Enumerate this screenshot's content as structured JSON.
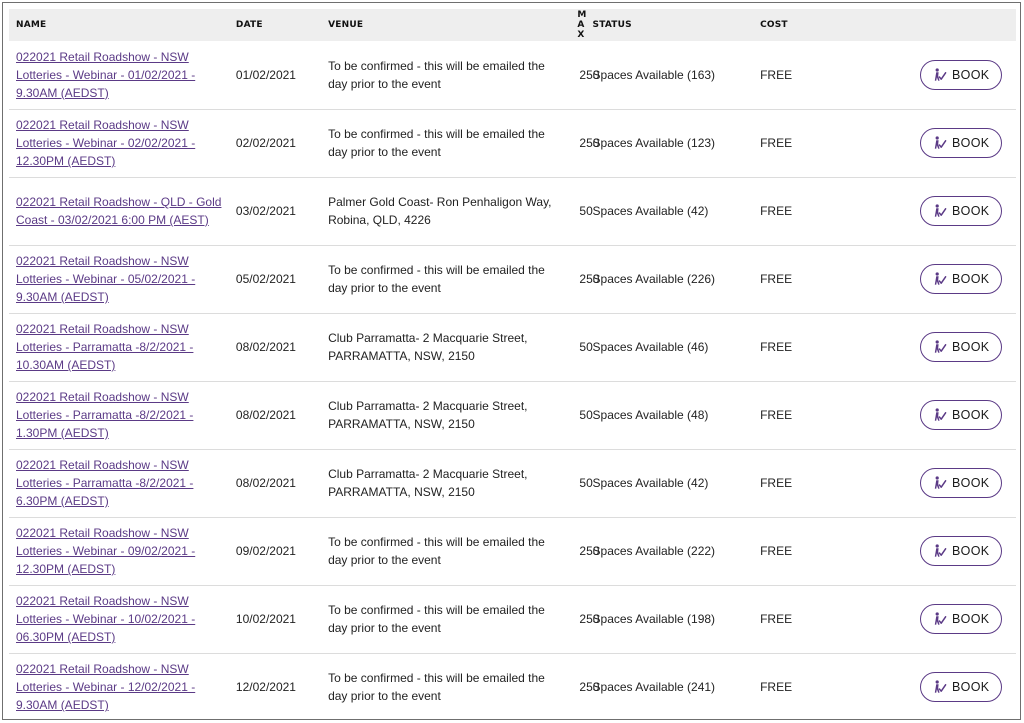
{
  "table": {
    "headers": {
      "name": "NAME",
      "date": "DATE",
      "venue": "VENUE",
      "max": "MAX",
      "status": "STATUS",
      "cost": "COST"
    },
    "rows": [
      {
        "name": "022021 Retail Roadshow - NSW Lotteries - Webinar - 01/02/2021 - 9.30AM (AEDST)",
        "date": "01/02/2021",
        "venue": "To be confirmed - this will be emailed the day prior to the event",
        "max": "250",
        "status": "Spaces Available (163)",
        "cost": "FREE",
        "book": "BOOK"
      },
      {
        "name": "022021 Retail Roadshow - NSW Lotteries - Webinar - 02/02/2021 - 12.30PM (AEDST)",
        "date": "02/02/2021",
        "venue": "To be confirmed - this will be emailed the day prior to the event",
        "max": "250",
        "status": "Spaces Available (123)",
        "cost": "FREE",
        "book": "BOOK"
      },
      {
        "name": "022021 Retail Roadshow - QLD - Gold Coast - 03/02/2021 6:00 PM (AEST)",
        "date": "03/02/2021",
        "venue": "Palmer Gold Coast- Ron Penhaligon Way, Robina, QLD, 4226",
        "max": "50",
        "status": "Spaces Available (42)",
        "cost": "FREE",
        "book": "BOOK"
      },
      {
        "name": "022021 Retail Roadshow - NSW Lotteries - Webinar - 05/02/2021 - 9.30AM (AEDST)",
        "date": "05/02/2021",
        "venue": "To be confirmed - this will be emailed the day prior to the event",
        "max": "250",
        "status": "Spaces Available (226)",
        "cost": "FREE",
        "book": "BOOK"
      },
      {
        "name": "022021 Retail Roadshow - NSW Lotteries - Parramatta -8/2/2021 - 10.30AM (AEDST)",
        "date": "08/02/2021",
        "venue": "Club Parramatta- 2 Macquarie Street, PARRAMATTA, NSW, 2150",
        "max": "50",
        "status": "Spaces Available (46)",
        "cost": "FREE",
        "book": "BOOK"
      },
      {
        "name": "022021 Retail Roadshow - NSW Lotteries - Parramatta -8/2/2021 - 1.30PM (AEDST)",
        "date": "08/02/2021",
        "venue": "Club Parramatta- 2 Macquarie Street, PARRAMATTA, NSW, 2150",
        "max": "50",
        "status": "Spaces Available (48)",
        "cost": "FREE",
        "book": "BOOK"
      },
      {
        "name": "022021 Retail Roadshow - NSW Lotteries - Parramatta -8/2/2021 - 6.30PM (AEDST)",
        "date": "08/02/2021",
        "venue": "Club Parramatta- 2 Macquarie Street, PARRAMATTA, NSW, 2150",
        "max": "50",
        "status": "Spaces Available (42)",
        "cost": "FREE",
        "book": "BOOK"
      },
      {
        "name": "022021 Retail Roadshow - NSW Lotteries - Webinar - 09/02/2021 - 12.30PM (AEDST)",
        "date": "09/02/2021",
        "venue": "To be confirmed - this will be emailed the day prior to the event",
        "max": "250",
        "status": "Spaces Available (222)",
        "cost": "FREE",
        "book": "BOOK"
      },
      {
        "name": "022021 Retail Roadshow - NSW Lotteries - Webinar - 10/02/2021 - 06.30PM (AEDST)",
        "date": "10/02/2021",
        "venue": "To be confirmed - this will be emailed the day prior to the event",
        "max": "250",
        "status": "Spaces Available (198)",
        "cost": "FREE",
        "book": "BOOK"
      },
      {
        "name": "022021 Retail Roadshow - NSW Lotteries - Webinar - 12/02/2021 - 9.30AM (AEDST)",
        "date": "12/02/2021",
        "venue": "To be confirmed - this will be emailed the day prior to the event",
        "max": "250",
        "status": "Spaces Available (241)",
        "cost": "FREE",
        "book": "BOOK"
      }
    ]
  },
  "icons": {
    "book_button_icon": "person-walking-icon"
  },
  "colors": {
    "link": "#5b3a86",
    "button_border": "#5b3a86",
    "header_bg": "#eeeeee",
    "row_divider": "#dcdcdc"
  }
}
